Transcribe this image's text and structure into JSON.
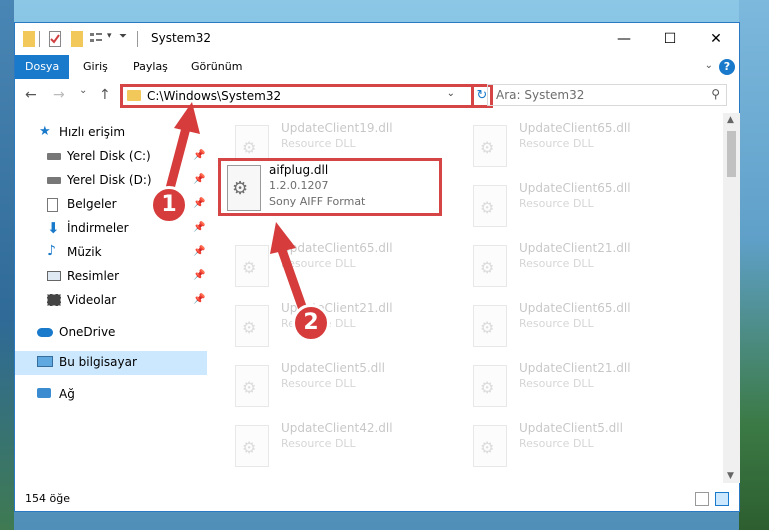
{
  "window": {
    "title": "System32",
    "controls": {
      "minimize": "—",
      "maximize": "☐",
      "close": "✕"
    }
  },
  "ribbon": {
    "tabs": [
      {
        "label": "Dosya",
        "active": true
      },
      {
        "label": "Giriş"
      },
      {
        "label": "Paylaş"
      },
      {
        "label": "Görünüm"
      }
    ],
    "help": "?"
  },
  "nav": {
    "back": "←",
    "forward": "→",
    "recent": "⌄",
    "up": "↑",
    "address": "C:\\Windows\\System32",
    "refresh": "↻",
    "search_placeholder": "Ara: System32"
  },
  "sidebar": {
    "items": [
      {
        "label": "Hızlı erişim",
        "icon": "star-icon",
        "pinned": false
      },
      {
        "label": "Yerel Disk (C:)",
        "icon": "drive-icon",
        "pinned": true
      },
      {
        "label": "Yerel Disk (D:)",
        "icon": "drive-icon",
        "pinned": true
      },
      {
        "label": "Belgeler",
        "icon": "documents-icon",
        "pinned": true
      },
      {
        "label": "İndirmeler",
        "icon": "download-icon",
        "pinned": true
      },
      {
        "label": "Müzik",
        "icon": "music-icon",
        "pinned": true
      },
      {
        "label": "Resimler",
        "icon": "pictures-icon",
        "pinned": true
      },
      {
        "label": "Videolar",
        "icon": "videos-icon",
        "pinned": true
      },
      {
        "label": "OneDrive",
        "icon": "cloud-icon",
        "pinned": false
      },
      {
        "label": "Bu bilgisayar",
        "icon": "computer-icon",
        "pinned": false,
        "selected": true
      },
      {
        "label": "Ağ",
        "icon": "network-icon",
        "pinned": false
      }
    ]
  },
  "files": {
    "highlighted": {
      "name": "aifplug.dll",
      "version": "1.2.0.1207",
      "description": "Sony AIFF Format"
    },
    "left_column": [
      {
        "name": "UpdateClient19.dll",
        "description": "Resource DLL"
      },
      {
        "name": "UpdateClient65.dll",
        "description": "Resource DLL"
      },
      {
        "name": "UpdateClient21.dll",
        "description": "Resource DLL"
      },
      {
        "name": "UpdateClient5.dll",
        "description": "Resource DLL"
      },
      {
        "name": "UpdateClient42.dll",
        "description": "Resource DLL"
      }
    ],
    "right_column": [
      {
        "name": "UpdateClient65.dll",
        "description": "Resource DLL"
      },
      {
        "name": "UpdateClient65.dll",
        "description": "Resource DLL"
      },
      {
        "name": "UpdateClient21.dll",
        "description": "Resource DLL"
      },
      {
        "name": "UpdateClient65.dll",
        "description": "Resource DLL"
      },
      {
        "name": "UpdateClient21.dll",
        "description": "Resource DLL"
      },
      {
        "name": "UpdateClient5.dll",
        "description": "Resource DLL"
      }
    ]
  },
  "status": {
    "count": "154 öğe"
  },
  "annotations": {
    "step1": "1",
    "step2": "2"
  },
  "colors": {
    "accent": "#1979ca",
    "highlight": "#d64545",
    "selected": "#cce8ff"
  }
}
